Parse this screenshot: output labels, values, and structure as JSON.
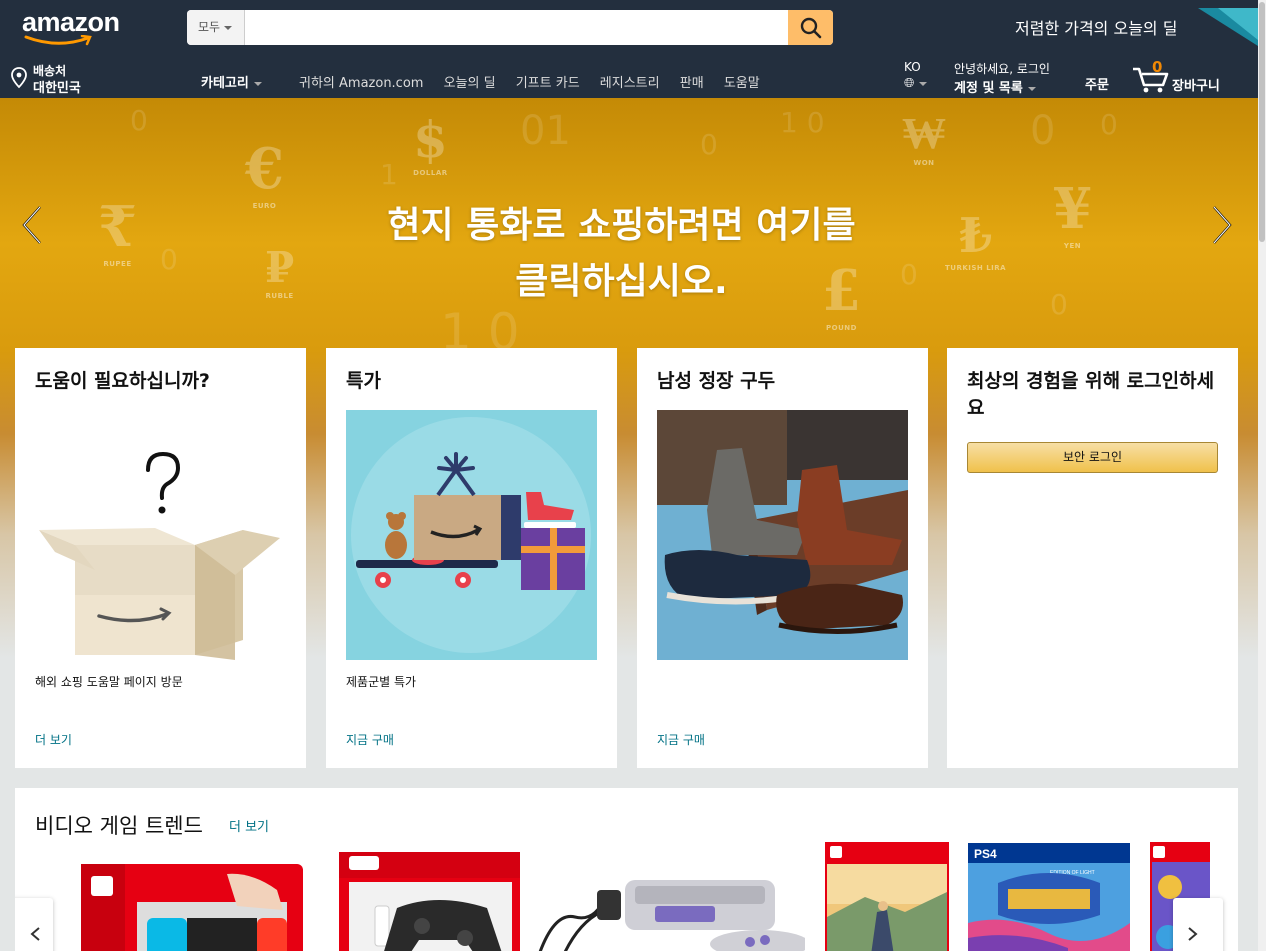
{
  "header": {
    "logo_text": "amazon",
    "search": {
      "department": "모두",
      "value": "",
      "placeholder": ""
    },
    "promo": "저렴한 가격의 오늘의 딜"
  },
  "nav": {
    "deliver_line1": "배송처",
    "deliver_line2": "대한민국",
    "shop_by": "카테고리",
    "links": [
      "귀하의 Amazon.com",
      "오늘의 딜",
      "기프트 카드",
      "레지스트리",
      "판매",
      "도움말"
    ],
    "language": "KO",
    "account_line1": "안녕하세요, 로그인",
    "account_line2": "계정 및 목록",
    "orders": "주문",
    "cart_count": "0",
    "cart_label": "장바구니"
  },
  "hero": {
    "line1": "현지 통화로 쇼핑하려면 여기를",
    "line2": "클릭하십시오.",
    "currencies": [
      {
        "symbol": "€",
        "caption": "EURO"
      },
      {
        "symbol": "$",
        "caption": "DOLLAR"
      },
      {
        "symbol": "₹",
        "caption": "RUPEE"
      },
      {
        "symbol": "₽",
        "caption": "RUBLE"
      },
      {
        "symbol": "₩",
        "caption": "WON"
      },
      {
        "symbol": "¥",
        "caption": "YEN"
      },
      {
        "symbol": "₺",
        "caption": "TURKISH LIRA"
      },
      {
        "symbol": "£",
        "caption": "POUND"
      }
    ]
  },
  "cards": [
    {
      "title": "도움이 필요하십니까?",
      "desc": "해외 쇼핑 도움말 페이지 방문",
      "link": "더 보기"
    },
    {
      "title": "특가",
      "desc": "제품군별 특가",
      "link": "지금 구매"
    },
    {
      "title": "남성 정장 구두",
      "desc": "",
      "link": "지금 구매"
    },
    {
      "title": "최상의 경험을 위해 로그인하세요",
      "button": "보안 로그인"
    }
  ],
  "trend": {
    "title": "비디오 게임 트렌드",
    "see_all": "더 보기",
    "product_labels": [
      "PS4",
      "EDITION OF LIGHT"
    ]
  },
  "colors": {
    "nav_bg": "#232f3e",
    "search_button": "#febd69",
    "link": "#007185",
    "cart_count": "#f08804",
    "signin_button": "#f0c14b"
  }
}
